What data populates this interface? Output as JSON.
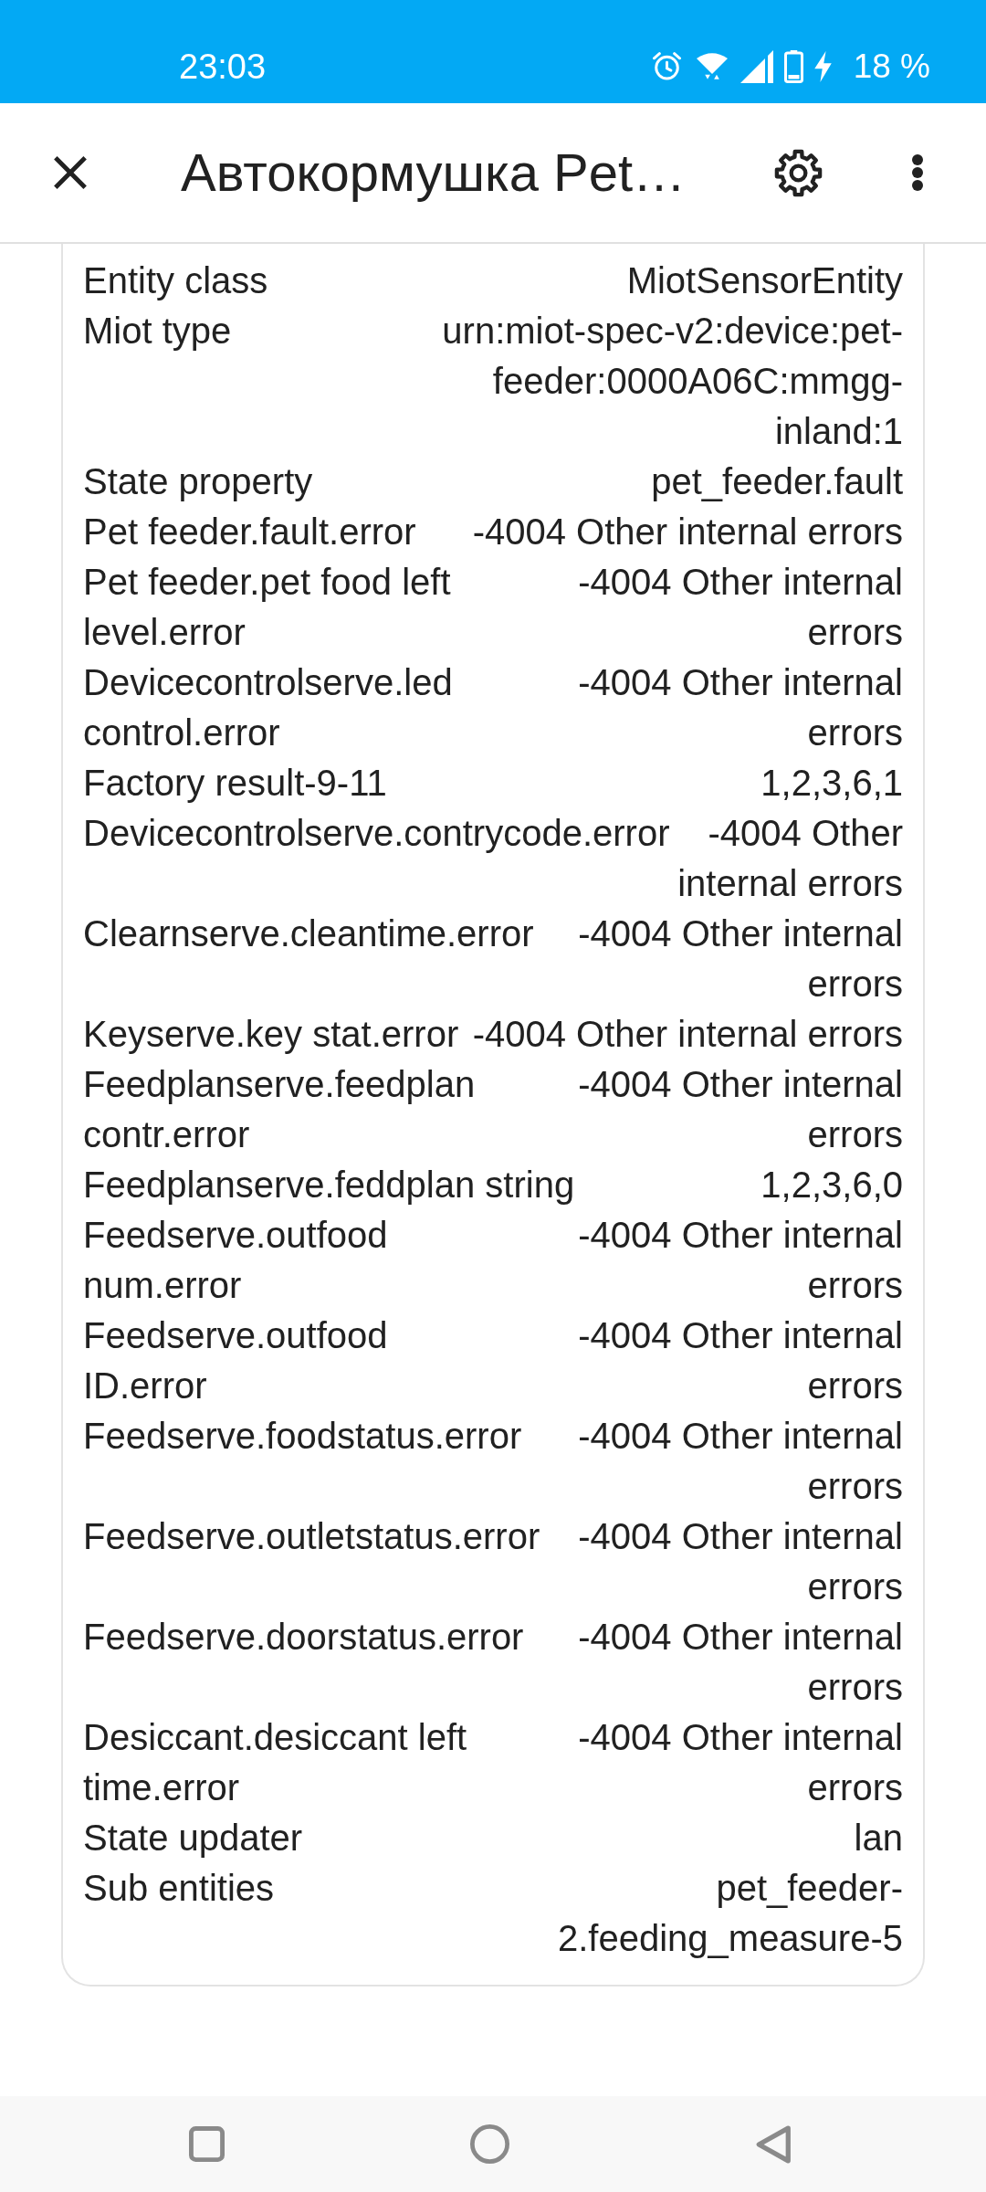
{
  "status_bar": {
    "time": "23:03",
    "battery_percent": "18 %"
  },
  "header": {
    "title": "Автокормушка Pet…"
  },
  "attributes": [
    {
      "name": "Entity class",
      "value": "MiotSensorEntity"
    },
    {
      "name": "Miot type",
      "value": "urn:miot-spec-v2:device:pet-feeder:0000A06C:mmgg-inland:1"
    },
    {
      "name": "State property",
      "value": "pet_feeder.fault"
    },
    {
      "name": "Pet feeder.fault.error",
      "value": "-4004 Other internal errors"
    },
    {
      "name": "Pet feeder.pet food left level.error",
      "value": "-4004 Other internal errors"
    },
    {
      "name": "Devicecontrolserve.led control.error",
      "value": "-4004 Other internal errors"
    },
    {
      "name": "Factory result-9-11",
      "value": "1,2,3,6,1"
    },
    {
      "name": "Devicecontrolserve.contrycode.error",
      "value": "-4004 Other internal errors"
    },
    {
      "name": "Clearnserve.cleantime.error",
      "value": "-4004 Other internal errors"
    },
    {
      "name": "Keyserve.key stat.error",
      "value": "-4004 Other internal errors"
    },
    {
      "name": "Feedplanserve.feedplan contr.error",
      "value": "-4004 Other internal errors"
    },
    {
      "name": "Feedplanserve.feddplan string",
      "value": "1,2,3,6,0"
    },
    {
      "name": "Feedserve.outfood num.error",
      "value": "-4004 Other internal errors"
    },
    {
      "name": "Feedserve.outfood ID.error",
      "value": "-4004 Other internal errors"
    },
    {
      "name": "Feedserve.foodstatus.error",
      "value": "-4004 Other internal errors"
    },
    {
      "name": "Feedserve.outletstatus.error",
      "value": "-4004 Other internal errors"
    },
    {
      "name": "Feedserve.doorstatus.error",
      "value": "-4004 Other internal errors"
    },
    {
      "name": "Desiccant.desiccant left time.error",
      "value": "-4004 Other internal errors"
    },
    {
      "name": "State updater",
      "value": "lan"
    },
    {
      "name": "Sub entities",
      "value": "pet_feeder-2.feeding_measure-5"
    }
  ]
}
